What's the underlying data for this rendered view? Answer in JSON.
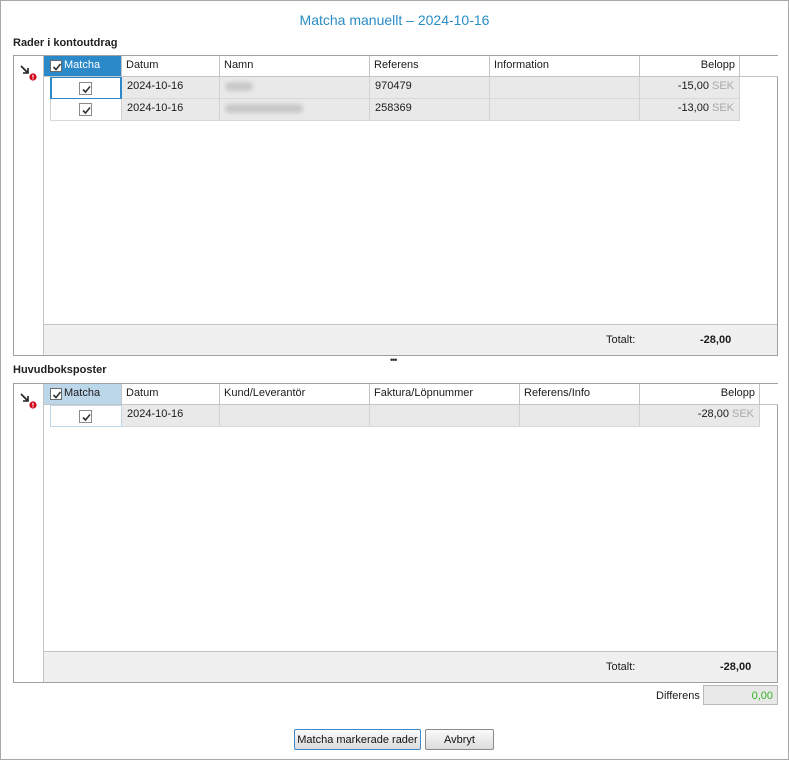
{
  "dialog": {
    "title": "Matcha manuellt – 2024-10-16"
  },
  "statement": {
    "section_label": "Rader i kontoutdrag",
    "columns": {
      "match": "Matcha",
      "date": "Datum",
      "name": "Namn",
      "reference": "Referens",
      "information": "Information",
      "amount": "Belopp"
    },
    "rows": [
      {
        "checked": true,
        "date": "2024-10-16",
        "name": "",
        "reference": "970479",
        "information": "",
        "amount": "-15,00",
        "currency": "SEK"
      },
      {
        "checked": true,
        "date": "2024-10-16",
        "name": "",
        "reference": "258369",
        "information": "",
        "amount": "-13,00",
        "currency": "SEK"
      }
    ],
    "total_label": "Totalt:",
    "total_value": "-28,00"
  },
  "ledger": {
    "section_label": "Huvudboksposter",
    "columns": {
      "match": "Matcha",
      "date": "Datum",
      "party": "Kund/Leverantör",
      "invoice": "Faktura/Löpnummer",
      "ref_info": "Referens/Info",
      "amount": "Belopp"
    },
    "rows": [
      {
        "checked": true,
        "date": "2024-10-16",
        "party": "",
        "invoice": "",
        "ref_info": "",
        "amount": "-28,00",
        "currency": "SEK"
      }
    ],
    "total_label": "Totalt:",
    "total_value": "-28,00"
  },
  "difference": {
    "label": "Differens",
    "value": "0,00"
  },
  "buttons": {
    "match_selected": "Matcha markerade rader",
    "cancel": "Avbryt"
  },
  "icons": {
    "row_header": "arrow-warning-icon",
    "checkbox": "checkmark-icon",
    "splitter": "splitter-grip-icon"
  },
  "colors": {
    "accent": "#2b89c9",
    "title": "#2a8dc5",
    "difference_ok": "#35b526",
    "error": "#d0021b"
  }
}
